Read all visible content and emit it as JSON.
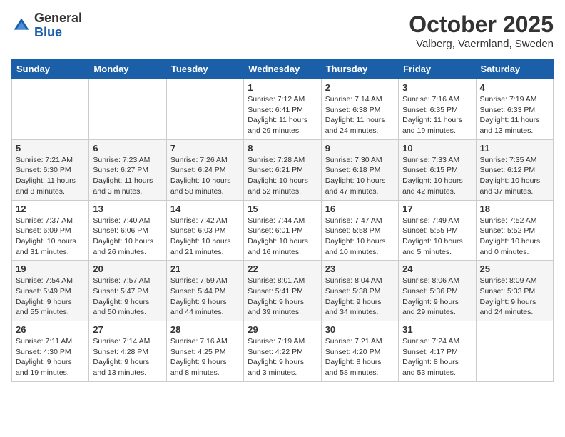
{
  "header": {
    "logo_general": "General",
    "logo_blue": "Blue",
    "month": "October 2025",
    "location": "Valberg, Vaermland, Sweden"
  },
  "days_of_week": [
    "Sunday",
    "Monday",
    "Tuesday",
    "Wednesday",
    "Thursday",
    "Friday",
    "Saturday"
  ],
  "weeks": [
    [
      {
        "day": "",
        "info": ""
      },
      {
        "day": "",
        "info": ""
      },
      {
        "day": "",
        "info": ""
      },
      {
        "day": "1",
        "info": "Sunrise: 7:12 AM\nSunset: 6:41 PM\nDaylight: 11 hours\nand 29 minutes."
      },
      {
        "day": "2",
        "info": "Sunrise: 7:14 AM\nSunset: 6:38 PM\nDaylight: 11 hours\nand 24 minutes."
      },
      {
        "day": "3",
        "info": "Sunrise: 7:16 AM\nSunset: 6:35 PM\nDaylight: 11 hours\nand 19 minutes."
      },
      {
        "day": "4",
        "info": "Sunrise: 7:19 AM\nSunset: 6:33 PM\nDaylight: 11 hours\nand 13 minutes."
      }
    ],
    [
      {
        "day": "5",
        "info": "Sunrise: 7:21 AM\nSunset: 6:30 PM\nDaylight: 11 hours\nand 8 minutes."
      },
      {
        "day": "6",
        "info": "Sunrise: 7:23 AM\nSunset: 6:27 PM\nDaylight: 11 hours\nand 3 minutes."
      },
      {
        "day": "7",
        "info": "Sunrise: 7:26 AM\nSunset: 6:24 PM\nDaylight: 10 hours\nand 58 minutes."
      },
      {
        "day": "8",
        "info": "Sunrise: 7:28 AM\nSunset: 6:21 PM\nDaylight: 10 hours\nand 52 minutes."
      },
      {
        "day": "9",
        "info": "Sunrise: 7:30 AM\nSunset: 6:18 PM\nDaylight: 10 hours\nand 47 minutes."
      },
      {
        "day": "10",
        "info": "Sunrise: 7:33 AM\nSunset: 6:15 PM\nDaylight: 10 hours\nand 42 minutes."
      },
      {
        "day": "11",
        "info": "Sunrise: 7:35 AM\nSunset: 6:12 PM\nDaylight: 10 hours\nand 37 minutes."
      }
    ],
    [
      {
        "day": "12",
        "info": "Sunrise: 7:37 AM\nSunset: 6:09 PM\nDaylight: 10 hours\nand 31 minutes."
      },
      {
        "day": "13",
        "info": "Sunrise: 7:40 AM\nSunset: 6:06 PM\nDaylight: 10 hours\nand 26 minutes."
      },
      {
        "day": "14",
        "info": "Sunrise: 7:42 AM\nSunset: 6:03 PM\nDaylight: 10 hours\nand 21 minutes."
      },
      {
        "day": "15",
        "info": "Sunrise: 7:44 AM\nSunset: 6:01 PM\nDaylight: 10 hours\nand 16 minutes."
      },
      {
        "day": "16",
        "info": "Sunrise: 7:47 AM\nSunset: 5:58 PM\nDaylight: 10 hours\nand 10 minutes."
      },
      {
        "day": "17",
        "info": "Sunrise: 7:49 AM\nSunset: 5:55 PM\nDaylight: 10 hours\nand 5 minutes."
      },
      {
        "day": "18",
        "info": "Sunrise: 7:52 AM\nSunset: 5:52 PM\nDaylight: 10 hours\nand 0 minutes."
      }
    ],
    [
      {
        "day": "19",
        "info": "Sunrise: 7:54 AM\nSunset: 5:49 PM\nDaylight: 9 hours\nand 55 minutes."
      },
      {
        "day": "20",
        "info": "Sunrise: 7:57 AM\nSunset: 5:47 PM\nDaylight: 9 hours\nand 50 minutes."
      },
      {
        "day": "21",
        "info": "Sunrise: 7:59 AM\nSunset: 5:44 PM\nDaylight: 9 hours\nand 44 minutes."
      },
      {
        "day": "22",
        "info": "Sunrise: 8:01 AM\nSunset: 5:41 PM\nDaylight: 9 hours\nand 39 minutes."
      },
      {
        "day": "23",
        "info": "Sunrise: 8:04 AM\nSunset: 5:38 PM\nDaylight: 9 hours\nand 34 minutes."
      },
      {
        "day": "24",
        "info": "Sunrise: 8:06 AM\nSunset: 5:36 PM\nDaylight: 9 hours\nand 29 minutes."
      },
      {
        "day": "25",
        "info": "Sunrise: 8:09 AM\nSunset: 5:33 PM\nDaylight: 9 hours\nand 24 minutes."
      }
    ],
    [
      {
        "day": "26",
        "info": "Sunrise: 7:11 AM\nSunset: 4:30 PM\nDaylight: 9 hours\nand 19 minutes."
      },
      {
        "day": "27",
        "info": "Sunrise: 7:14 AM\nSunset: 4:28 PM\nDaylight: 9 hours\nand 13 minutes."
      },
      {
        "day": "28",
        "info": "Sunrise: 7:16 AM\nSunset: 4:25 PM\nDaylight: 9 hours\nand 8 minutes."
      },
      {
        "day": "29",
        "info": "Sunrise: 7:19 AM\nSunset: 4:22 PM\nDaylight: 9 hours\nand 3 minutes."
      },
      {
        "day": "30",
        "info": "Sunrise: 7:21 AM\nSunset: 4:20 PM\nDaylight: 8 hours\nand 58 minutes."
      },
      {
        "day": "31",
        "info": "Sunrise: 7:24 AM\nSunset: 4:17 PM\nDaylight: 8 hours\nand 53 minutes."
      },
      {
        "day": "",
        "info": ""
      }
    ]
  ]
}
